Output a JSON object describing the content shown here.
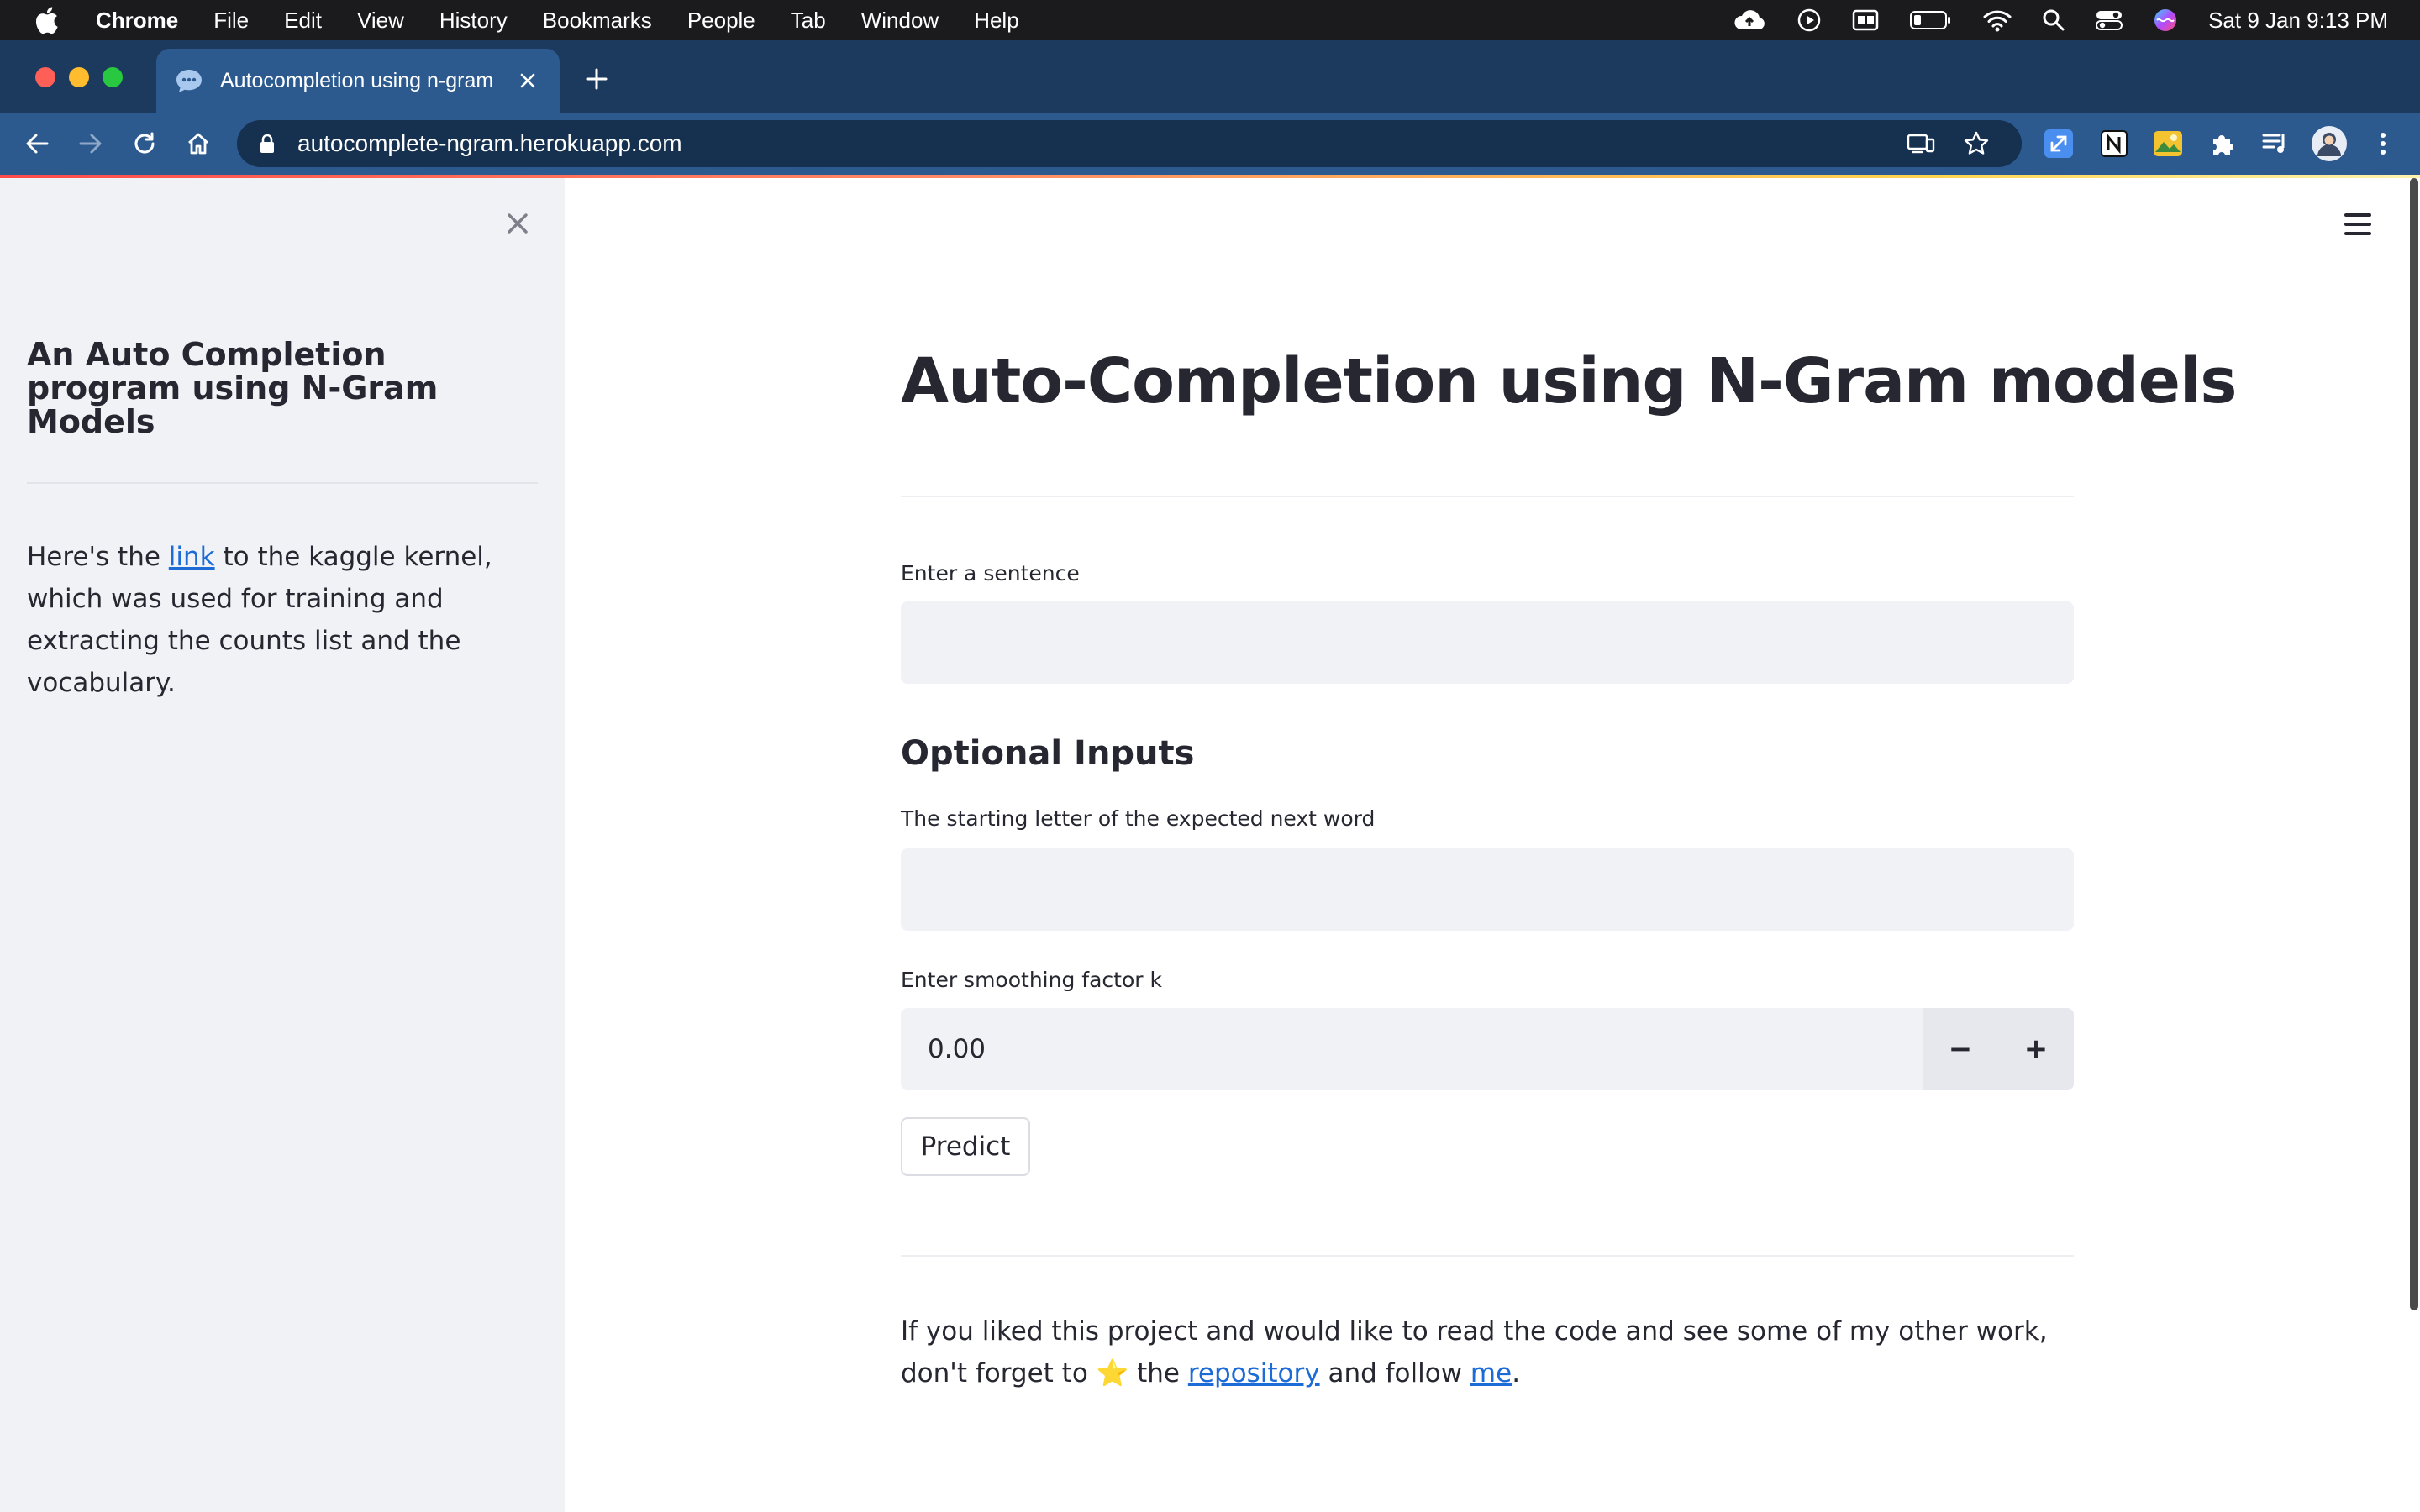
{
  "menubar": {
    "app_name": "Chrome",
    "items": [
      "File",
      "Edit",
      "View",
      "History",
      "Bookmarks",
      "People",
      "Tab",
      "Window",
      "Help"
    ],
    "clock": "Sat 9 Jan  9:13 PM"
  },
  "browser": {
    "tab_title": "Autocompletion using n-gram",
    "url": "autocomplete-ngram.herokuapp.com"
  },
  "sidebar": {
    "title": "An Auto Completion program using N-Gram Models",
    "text_before_link": "Here's the ",
    "link_text": "link",
    "text_after_link": " to the kaggle kernel, which was used for training and extracting the counts list and the vocabulary."
  },
  "main": {
    "title": "Auto-Completion using N-Gram models",
    "sentence_label": "Enter a sentence",
    "sentence_value": "",
    "optional_heading": "Optional Inputs",
    "letter_label": "The starting letter of the expected next word",
    "letter_value": "",
    "smoothing_label": "Enter smoothing factor k",
    "smoothing_value": "0.00",
    "minus_label": "−",
    "plus_label": "+",
    "predict_label": "Predict"
  },
  "footer": {
    "text_1": "If you liked this project and would like to read the code and see some of my other work, don't forget to ",
    "star": "⭐",
    "text_2": " the ",
    "repo_link": "repository",
    "text_3": " and follow ",
    "me_link": "me",
    "text_4": "."
  },
  "colors": {
    "tab_strip": "#1c3a5e",
    "toolbar": "#2c5a8f",
    "sidebar_bg": "#f0f2f6",
    "input_bg": "#f0f2f6",
    "link": "#1c6bd6",
    "text": "#262730"
  }
}
